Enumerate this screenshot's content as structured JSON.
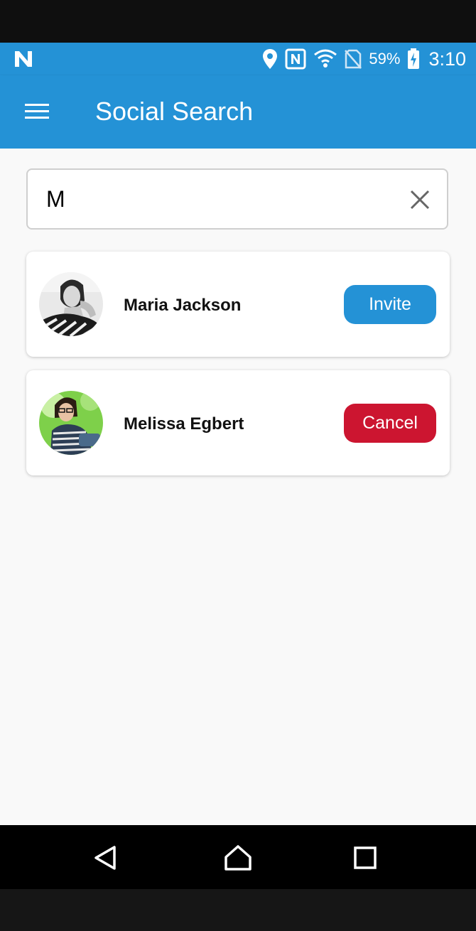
{
  "status_bar": {
    "app_icon": "n-notification-icon",
    "icons": [
      "location-icon",
      "nfc-icon",
      "wifi-icon",
      "no-sim-icon",
      "battery-charging-icon"
    ],
    "battery": "59%",
    "time": "3:10"
  },
  "app_bar": {
    "menu_icon": "hamburger-menu-icon",
    "title": "Social Search"
  },
  "search": {
    "value": "M",
    "clear_icon": "close-icon"
  },
  "results": [
    {
      "name": "Maria Jackson",
      "action": "Invite",
      "action_color": "#2492d6"
    },
    {
      "name": "Melissa Egbert",
      "action": "Cancel",
      "action_color": "#cc1530"
    }
  ],
  "nav_bar": {
    "back_icon": "back-triangle-icon",
    "home_icon": "home-icon",
    "recents_icon": "recents-square-icon"
  },
  "colors": {
    "primary": "#2492d6",
    "danger": "#cc1530",
    "background": "#f9f9f9"
  }
}
